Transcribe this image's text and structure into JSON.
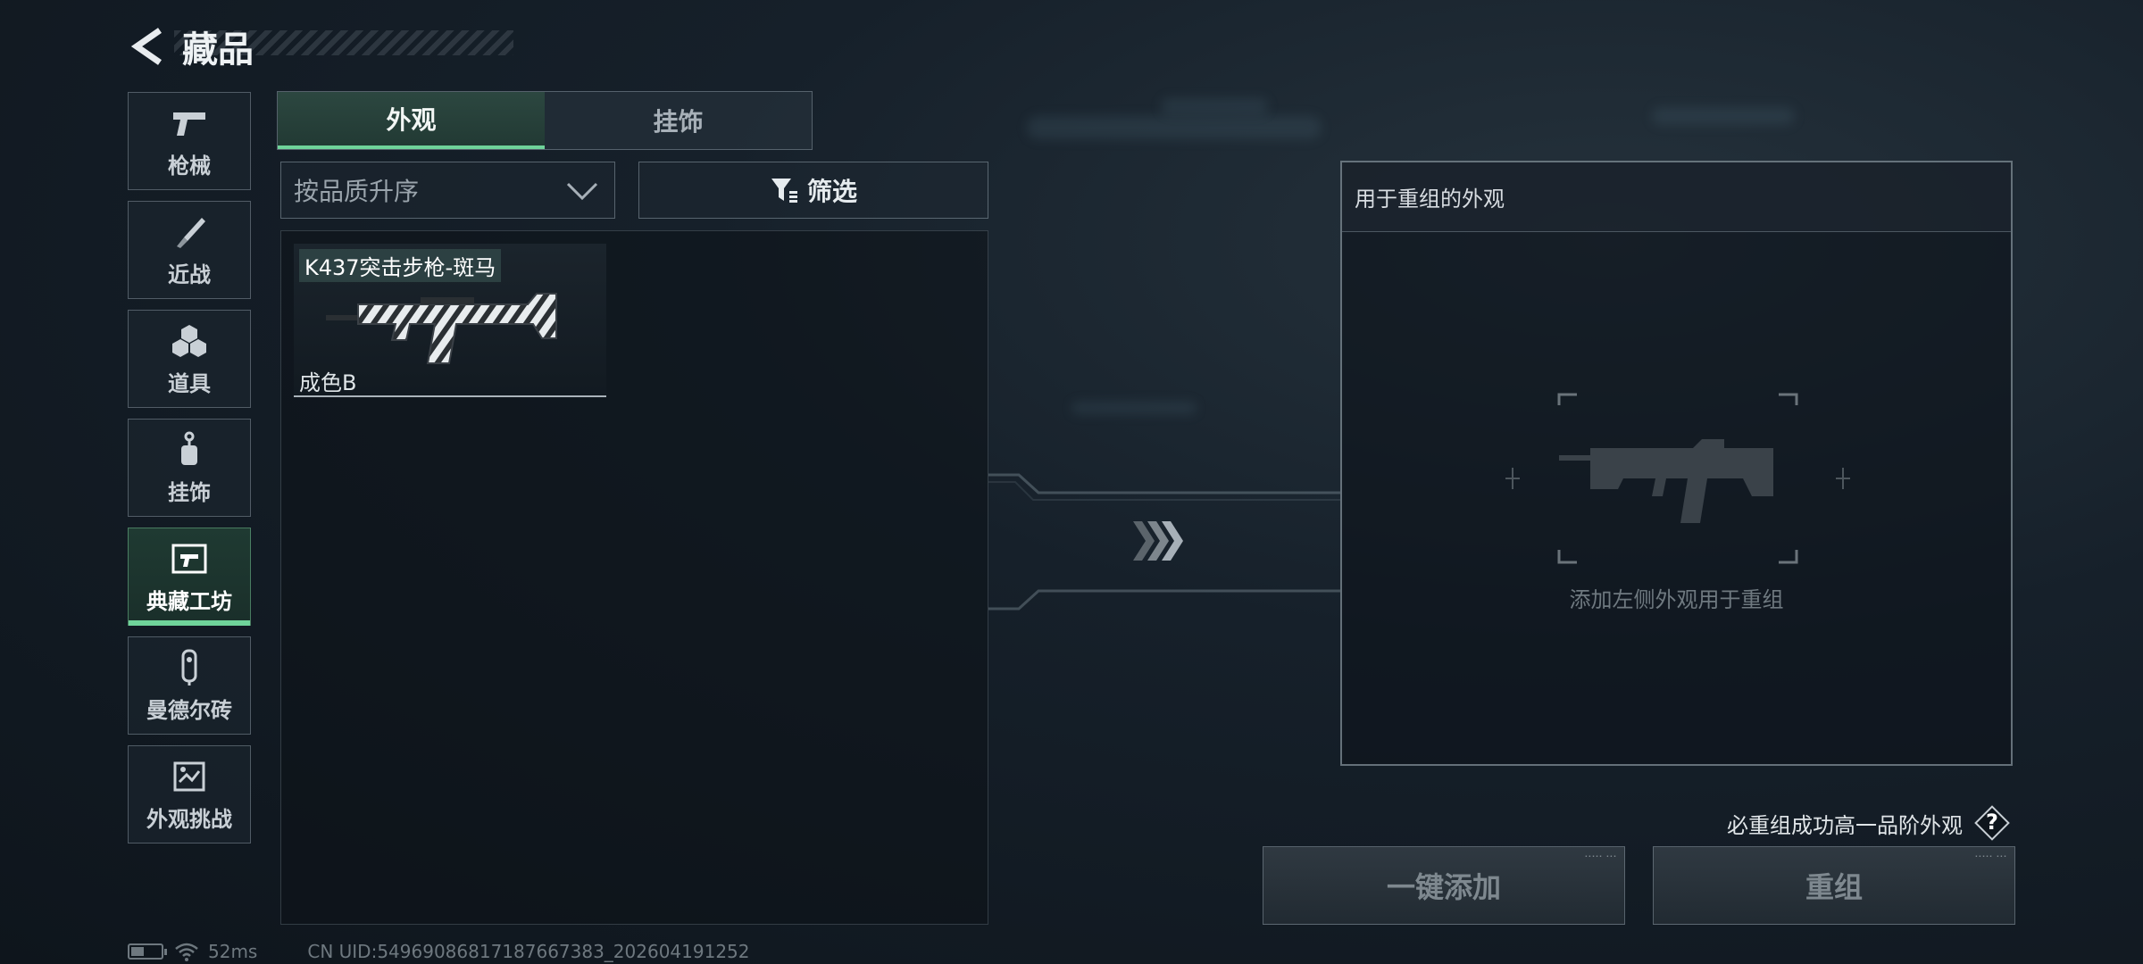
{
  "header": {
    "title": "藏品"
  },
  "sidebar": {
    "items": [
      {
        "label": "枪械",
        "icon": "pistol-icon",
        "active": false
      },
      {
        "label": "近战",
        "icon": "knife-icon",
        "active": false
      },
      {
        "label": "道具",
        "icon": "grenade-icon",
        "active": false
      },
      {
        "label": "挂饰",
        "icon": "charm-icon",
        "active": false
      },
      {
        "label": "典藏工坊",
        "icon": "workshop-icon",
        "active": true
      },
      {
        "label": "曼德尔砖",
        "icon": "brick-icon",
        "active": false
      },
      {
        "label": "外观挑战",
        "icon": "challenge-icon",
        "active": false
      }
    ]
  },
  "tabs": [
    {
      "label": "外观",
      "active": true
    },
    {
      "label": "挂饰",
      "active": false
    }
  ],
  "sort": {
    "value": "按品质升序"
  },
  "filter": {
    "label": "筛选"
  },
  "items": [
    {
      "name": "K437突击步枪-斑马",
      "grade": "成色B"
    }
  ],
  "recombine": {
    "header": "用于重组的外观",
    "hint": "添加左侧外观用于重组",
    "requirement": "必重组成功高一品阶外观",
    "help_label": "?",
    "add_all_label": "一键添加",
    "recombine_label": "重组"
  },
  "status": {
    "ping": "52ms",
    "uid": "CN UID:54969086817187667383_202604191252"
  },
  "colors": {
    "accent": "#6fd39a",
    "background": "#16202a",
    "text": "#d8dde2"
  }
}
